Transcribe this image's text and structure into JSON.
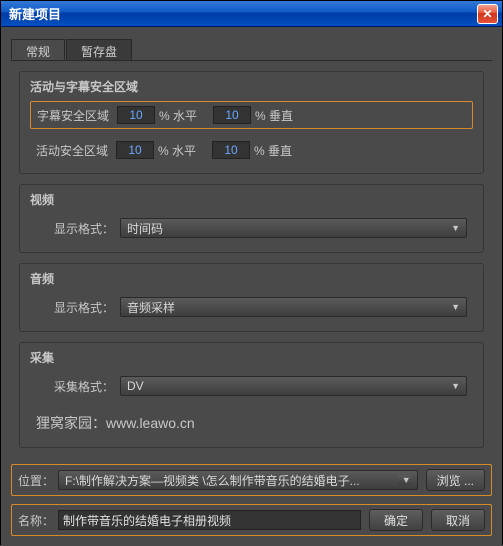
{
  "window": {
    "title": "新建项目"
  },
  "tabs": {
    "general": "常规",
    "scratch": "暂存盘"
  },
  "groups": {
    "safe": {
      "title": "活动与字幕安全区域",
      "row1_label": "字幕安全区域",
      "row2_label": "活动安全区域",
      "h_label": "% 水平",
      "v_label": "% 垂直",
      "title_h": "10",
      "title_v": "10",
      "action_h": "10",
      "action_v": "10"
    },
    "video": {
      "title": "视频",
      "format_label": "显示格式：",
      "format_value": "时间码"
    },
    "audio": {
      "title": "音频",
      "format_label": "显示格式：",
      "format_value": "音频采样"
    },
    "capture": {
      "title": "采集",
      "format_label": "采集格式：",
      "format_value": "DV"
    }
  },
  "watermark": "狸窝家园：www.leawo.cn",
  "location": {
    "label": "位置：",
    "value": "F:\\制作解决方案—视频类 \\怎么制作带音乐的结婚电子...",
    "browse": "浏览 ..."
  },
  "name": {
    "label": "名称：",
    "value": "制作带音乐的结婚电子相册视频"
  },
  "buttons": {
    "ok": "确定",
    "cancel": "取消"
  }
}
